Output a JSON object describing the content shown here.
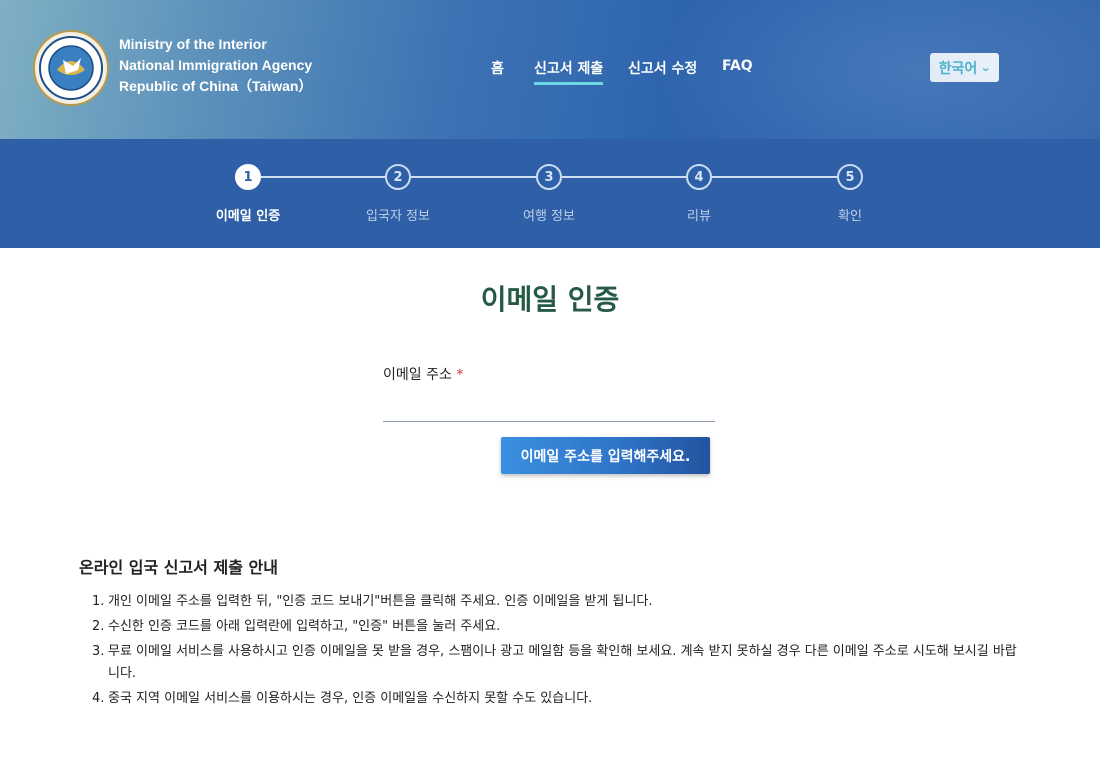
{
  "header": {
    "agency_lines": [
      "Ministry of the Interior",
      "National Immigration Agency",
      "Republic of China（Taiwan）"
    ],
    "logo_text": "National Immigration Agency"
  },
  "nav": {
    "items": [
      {
        "label": "홈",
        "active": false
      },
      {
        "label": "신고서 제출",
        "active": true
      },
      {
        "label": "신고서 수정",
        "active": false
      },
      {
        "label": "FAQ",
        "active": false
      }
    ]
  },
  "language": {
    "selected": "한국어",
    "icon": "chevron-down-icon"
  },
  "stepper": {
    "current": 1,
    "steps": [
      {
        "num": "1",
        "label": "이메일 인증"
      },
      {
        "num": "2",
        "label": "입국자 정보"
      },
      {
        "num": "3",
        "label": "여행 정보"
      },
      {
        "num": "4",
        "label": "리뷰"
      },
      {
        "num": "5",
        "label": "확인"
      }
    ]
  },
  "main": {
    "title": "이메일 인증",
    "email_label": "이메일 주소",
    "required_mark": "*",
    "email_value": "",
    "submit_label": "이메일 주소를 입력해주세요."
  },
  "guide": {
    "title": "온라인 입국 신고서 제출 안내",
    "items": [
      {
        "num": "1.",
        "text": "개인 이메일 주소를 입력한 뒤, \"인증 코드 보내기\"버튼을 클릭해 주세요. 인증 이메일을 받게 됩니다."
      },
      {
        "num": "2.",
        "text": "수신한 인증 코드를 아래 입력란에 입력하고, \"인증\" 버튼을 눌러 주세요."
      },
      {
        "num": "3.",
        "text": "무료 이메일 서비스를 사용하시고 인증 이메일을 못 받을 경우, 스팸이나 광고 메일함 등을 확인해 보세요. 계속 받지 못하실 경우 다른 이메일 주소로 시도해 보시길 바랍니다."
      },
      {
        "num": "4.",
        "text": "중국 지역 이메일 서비스를 이용하시는 경우, 인증 이메일을 수신하지 못할 수도 있습니다."
      }
    ]
  },
  "colors": {
    "header_blue": "#2e5fa7",
    "accent_teal": "#3db3c8",
    "title_green": "#265a45",
    "required_red": "#d9343c"
  }
}
